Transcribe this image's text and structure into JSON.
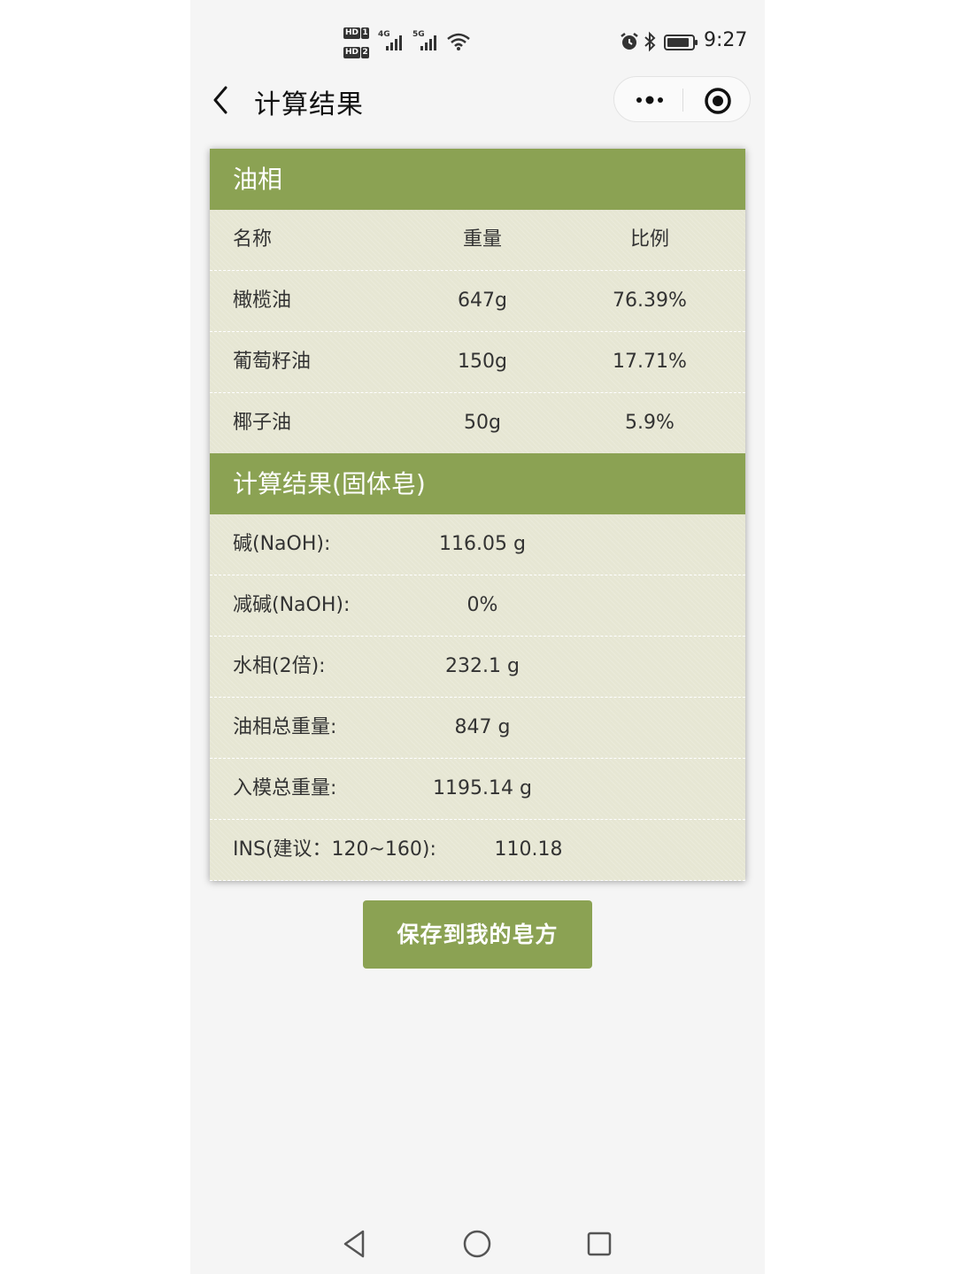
{
  "status_bar": {
    "hd1": "HD",
    "hd1_num": "1",
    "hd2": "HD",
    "hd2_num": "2",
    "net1": "4G",
    "net2": "5G",
    "time": "9:27"
  },
  "header": {
    "title": "计算结果"
  },
  "oil_section": {
    "title": "油相",
    "columns": [
      "名称",
      "重量",
      "比例"
    ],
    "rows": [
      {
        "name": "橄榄油",
        "weight": "647g",
        "ratio": "76.39%"
      },
      {
        "name": "葡萄籽油",
        "weight": "150g",
        "ratio": "17.71%"
      },
      {
        "name": "椰子油",
        "weight": "50g",
        "ratio": "5.9%"
      }
    ]
  },
  "result_section": {
    "title": "计算结果(固体皂)",
    "rows": [
      {
        "label": "碱(NaOH):",
        "value": "116.05 g"
      },
      {
        "label": "减碱(NaOH):",
        "value": "0%"
      },
      {
        "label": "水相(2倍):",
        "value": "232.1 g"
      },
      {
        "label": "油相总重量:",
        "value": "847 g"
      },
      {
        "label": "入模总重量:",
        "value": "1195.14 g"
      },
      {
        "label": "INS(建议：120~160):",
        "value": "110.18"
      }
    ]
  },
  "save_button": "保存到我的皂方",
  "colors": {
    "accent": "#8ba253",
    "card_bg": "#e6e6d3",
    "page_bg": "#f5f5f5"
  },
  "icons": {
    "back": "chevron-left-icon",
    "more": "more-dots-icon",
    "close": "target-circle-icon",
    "nav_back": "triangle-back-icon",
    "nav_home": "circle-home-icon",
    "nav_recent": "square-recent-icon"
  }
}
